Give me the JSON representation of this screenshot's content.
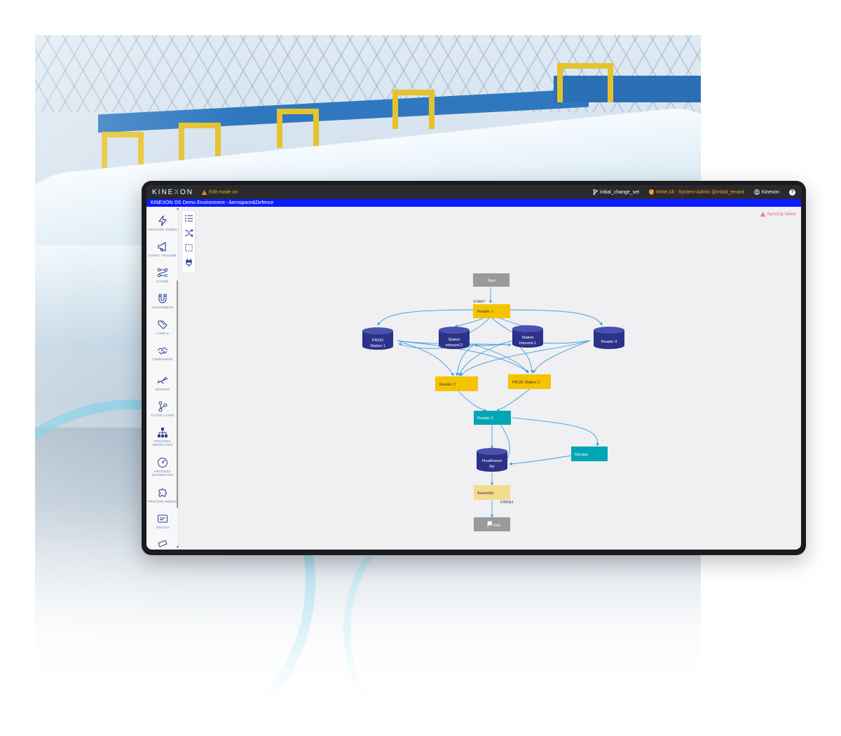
{
  "app": {
    "logo": "KINEXON",
    "edit_mode": "Edit mode on",
    "changeset": "initial_change_set",
    "permission": "Write All - System-Admin @initial_tenant",
    "user": "Kinexon",
    "help": "?"
  },
  "environment": "KINEXON OS Demo Environment - Aerospace&Defence",
  "sync_status": "Syncing failed",
  "sidebar": {
    "items": [
      {
        "label": "DECISION ZONES",
        "icon": "lightning-icon"
      },
      {
        "label": "EVENT TRIGGER",
        "icon": "megaphone-icon"
      },
      {
        "label": "FLOWS",
        "icon": "flows-icon"
      },
      {
        "label": "ASSIGNMENT",
        "icon": "magnet-icon"
      },
      {
        "label": "LABELS",
        "icon": "tag-icon"
      },
      {
        "label": "COMPANION",
        "icon": "handshake-icon"
      },
      {
        "label": "BOARDS",
        "icon": "plane-icon"
      },
      {
        "label": "FILTER LAYER",
        "icon": "filter-layer-icon"
      },
      {
        "label": "PROCESS MODELLING",
        "icon": "hierarchy-icon"
      },
      {
        "label": "PROCESS DASHBOARD",
        "icon": "gauge-icon"
      },
      {
        "label": "PROCESS MINING",
        "icon": "puzzle-icon"
      },
      {
        "label": "SPACES",
        "icon": "spaces-icon"
      }
    ]
  },
  "tools": [
    "list-icon",
    "shuffle-icon",
    "selection-icon",
    "plug-icon"
  ],
  "graph": {
    "nodes": {
      "start": "Start",
      "reader1": "Reader 1",
      "prod1_line1": "PROD",
      "prod1_line2": "Station 1",
      "inb2_line1": "Station",
      "inb2_line2": "Inbound 2",
      "inb1_line1": "Station",
      "inb1_line2": "Inbound 1",
      "reader4": "Reader 4",
      "reader3": "Reader 3",
      "prod2": "PROD Station 2",
      "reader2": "Reader 2",
      "final_line1": "FinalAssem",
      "final_line2": "bly",
      "storage": "Storage",
      "assembly": "Assembly",
      "end": "End"
    },
    "edge_labels": {
      "start": "START",
      "finish": "FINISH"
    }
  },
  "colors": {
    "accent_blue": "#0a1bff",
    "yellow_node": "#f5c400",
    "light_yellow_node": "#f3dc8c",
    "teal_node": "#00a6b5",
    "db_node": "#2c3288",
    "grey_node": "#9a9a9a",
    "edge": "#3aa0dc",
    "warning": "#f4a21c"
  }
}
